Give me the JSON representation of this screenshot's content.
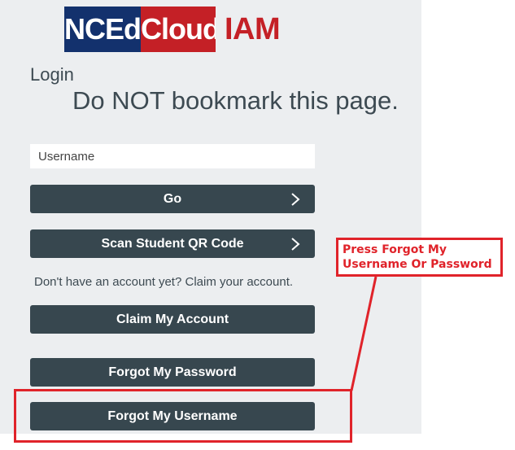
{
  "logo": {
    "part1": "NCEd",
    "part2": "Cloud",
    "suffix": "IAM"
  },
  "login_label": "Login",
  "warning": "Do NOT bookmark this page.",
  "username": {
    "placeholder": "Username",
    "value": ""
  },
  "buttons": {
    "go": "Go",
    "scan_qr": "Scan Student QR Code",
    "claim_account": "Claim My Account",
    "forgot_password": "Forgot My Password",
    "forgot_username": "Forgot My Username"
  },
  "claim_text": "Don't have an account yet? Claim your account.",
  "annotation": {
    "line1": "Press Forgot My",
    "line2": "Username Or Password",
    "color": "#e0232a"
  },
  "colors": {
    "button_bg": "#37474f",
    "panel_bg": "#eceef0",
    "logo_blue": "#13316d",
    "logo_red": "#c42026"
  },
  "icons": {
    "chevron": "chevron-right-icon"
  }
}
